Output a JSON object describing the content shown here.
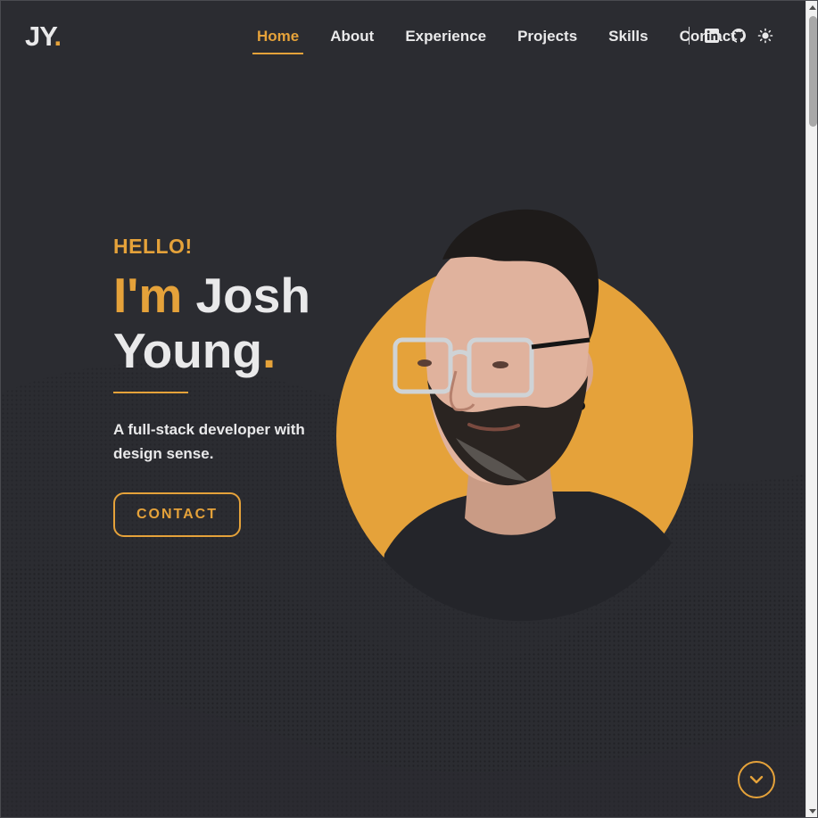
{
  "logo": {
    "text": "JY",
    "dot": "."
  },
  "nav": {
    "items": [
      {
        "label": "Home",
        "active": true
      },
      {
        "label": "About",
        "active": false
      },
      {
        "label": "Experience",
        "active": false
      },
      {
        "label": "Projects",
        "active": false
      },
      {
        "label": "Skills",
        "active": false
      },
      {
        "label": "Contact",
        "active": false
      }
    ],
    "icons": [
      "linkedin-icon",
      "github-icon",
      "sun-icon"
    ]
  },
  "hero": {
    "greeting": "HELLO!",
    "headline_prefix": "I'm",
    "headline_name_line1": "Josh",
    "headline_name_line2": "Young",
    "headline_dot": ".",
    "tagline": "A full-stack developer with design sense.",
    "cta_label": "CONTACT"
  },
  "colors": {
    "background": "#2b2c31",
    "accent": "#e5a23a",
    "text": "#e9e9ea"
  }
}
